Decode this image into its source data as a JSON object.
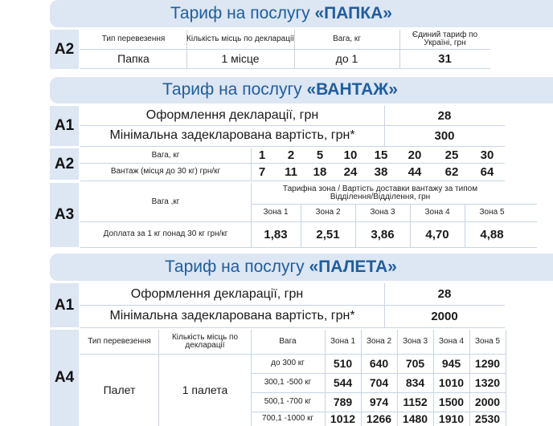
{
  "papka": {
    "title_prefix": "Тариф на послугу ",
    "title_name": "«ПАПКА»",
    "code": "A2",
    "headers": [
      "Тип перевезення",
      "Кількість місць по декларації",
      "Вага, кг",
      "Єдиний тариф по Україні, грн"
    ],
    "values": [
      "Папка",
      "1 місце",
      "до 1",
      "31"
    ]
  },
  "vantazh": {
    "title_prefix": "Тариф на послугу ",
    "title_name": "«ВАНТАЖ»",
    "a1": {
      "code": "A1",
      "rows": [
        {
          "label": "Оформлення декларації, грн",
          "value": "28"
        },
        {
          "label": "Мінімальна задекларована вартість, грн*",
          "value": "300"
        }
      ]
    },
    "a2": {
      "code": "A2",
      "weight_label": "Вага, кг",
      "weights": [
        "1",
        "2",
        "5",
        "10",
        "15",
        "20",
        "25",
        "30"
      ],
      "price_label": "Вантаж (місця до 30 кг) грн/кг",
      "prices": [
        "7",
        "11",
        "18",
        "24",
        "38",
        "44",
        "62",
        "64"
      ]
    },
    "a3": {
      "code": "A3",
      "weight_label": "Вага ,кг",
      "zone_header": "Тарифна зона  / Вартість доставки вантажу за типом Відділення/Відділення, грн",
      "zones": [
        "Зона 1",
        "Зона 2",
        "Зона 3",
        "Зона 4",
        "Зона 5"
      ],
      "surcharge_label": "Доплата за 1 кг понад 30 кг грн/кг",
      "surcharges": [
        "1,83",
        "2,51",
        "3,86",
        "4,70",
        "4,88"
      ]
    }
  },
  "paleta": {
    "title_prefix": "Тариф на послугу ",
    "title_name": "«ПАЛЕТА»",
    "a1": {
      "code": "A1",
      "rows": [
        {
          "label": "Оформлення декларації, грн",
          "value": "28"
        },
        {
          "label": "Мінімальна задекларована вартість, грн*",
          "value": "2000"
        }
      ]
    },
    "a4": {
      "code": "A4",
      "type_header": "Тип перевезення",
      "count_header": "Кількість місць по декларації",
      "weight_header": "Вага",
      "zones": [
        "Зона 1",
        "Зона 2",
        "Зона 3",
        "Зона 4",
        "Зона 5"
      ],
      "type_value": "Палет",
      "count_value": "1 палета",
      "rows": [
        {
          "weight": "до 300 кг",
          "prices": [
            "510",
            "640",
            "705",
            "945",
            "1290"
          ]
        },
        {
          "weight": "300,1 -500 кг",
          "prices": [
            "544",
            "704",
            "834",
            "1010",
            "1320"
          ]
        },
        {
          "weight": "500,1 -700 кг",
          "prices": [
            "789",
            "974",
            "1152",
            "1500",
            "2000"
          ]
        },
        {
          "weight": "700,1 -1000 кг",
          "prices": [
            "1012",
            "1266",
            "1480",
            "1910",
            "2530"
          ]
        }
      ]
    }
  }
}
